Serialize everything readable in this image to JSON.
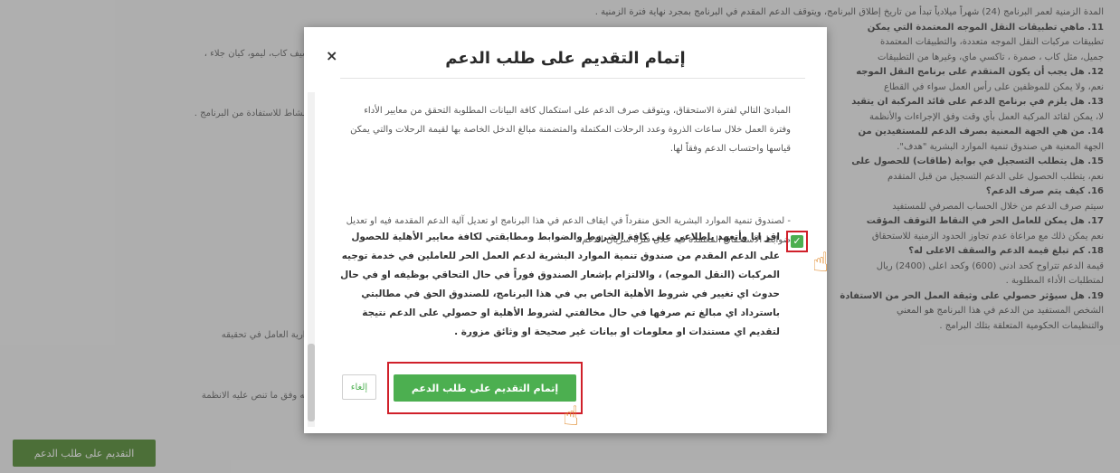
{
  "background": {
    "lines": [
      {
        "text": "المدة الزمنية لعمر البرنامج (24) شهراً ميلادياً تبدأ من تاريخ إطلاق البرنامج، ويتوقف الدعم المقدم في البرنامج بمجرد نهاية فترة الزمنية .",
        "q": false
      },
      {
        "text": "11. ماهي تطبيقات النقل الموجه المعتمدة التي يمكن",
        "q": true
      },
      {
        "text": "تطبيقات مركبات النقل الموجه متعددة، والتطبيقات المعتمدة",
        "q": false
      },
      {
        "text": "جميل، مثل كاب ، صمرة ، تاكسي ماي، وغيرها من التطبيقات",
        "q": false
      },
      {
        "text": "12. هل يجب أن يكون المتقدم على برنامج النقل الموجه",
        "q": true
      },
      {
        "text": "نعم، ولا يمكن للموظفين على رأس العمل سواء في القطاع",
        "q": false
      },
      {
        "text": "13. هل يلزم في برنامج الدعم على قائد المركبة ان يتقيد",
        "q": true
      },
      {
        "text": "لا، يمكن لقائد المركبة العمل بأي وقت وفق الإجراءات والأنظمة",
        "q": false
      },
      {
        "text": "14. من هي الجهة المعنية بصرف الدعم للمستفيدين من",
        "q": true
      },
      {
        "text": "الجهة المعنية هي صندوق تنمية الموارد البشرية \"هدف\".",
        "q": false
      },
      {
        "text": "15. هل يتطلب التسجيل في بوابة (طاقات) للحصول على",
        "q": true
      },
      {
        "text": "نعم، يتطلب الحصول على الدعم التسجيل من قبل المتقدم",
        "q": false
      },
      {
        "text": "16. كيف يتم صرف الدعم؟",
        "q": true
      },
      {
        "text": "سيتم صرف الدعم من خلال الحساب المصرفي للمستفيد",
        "q": false
      },
      {
        "text": "17. هل يمكن للعامل الحر في النقاط التوقف المؤقت",
        "q": true
      },
      {
        "text": "نعم يمكن ذلك مع مراعاة عدم تجاوز الحدود الزمنية للاستحقاق",
        "q": false
      },
      {
        "text": "18. كم تبلغ قيمة الدعم والسقف الاعلى له؟",
        "q": true
      },
      {
        "text": "قيمة الدعم تتراوح كحد ادنى (600) وكحد اعلى (2400) ريال",
        "q": false
      },
      {
        "text": "لمتطلبات الأداء المطلوبة .",
        "q": false
      },
      {
        "text": "19. هل سيؤثر حصولي على وثيقة العمل الحر من الاستفادة",
        "q": true
      },
      {
        "text": "الشخص المستفيد من الدعم في هذا البرنامج هو المعني",
        "q": false
      },
      {
        "text": "والتنظيمات الحكومية المتعلقة بتلك البرامج .",
        "q": false
      }
    ],
    "left_fragments": [
      "كريم، ماي تاكسي، او يو سيف كاب، ليمو، كيان جلاء ،",
      "فاد النقل العمل في هذا النشاط للاستفادة من البرنامج .",
      "شهر والمعتمد على استمرارية العامل في تحقيقه",
      "ات حكومية اخرى مقدمة له وفق ما تنص عليه الانظمة"
    ],
    "apply_button": "التقديم على طلب الدعم"
  },
  "modal": {
    "title": "إتمام التقديم على طلب الدعم",
    "close_symbol": "×",
    "paragraph1": "المبادئ التالي لفترة الاستحقاق، ويتوقف صرف الدعم على استكمال كافة البيانات المطلوبة التحقق من معايير الأداء وفترة العمل خلال ساعات الذروة وعدد الرحلات المكتملة والمتضمنة مبالغ الدخل الخاصة بها لقيمة الرحلات والتي يمكن قياسها واحتساب الدعم وفقاً لها.",
    "paragraph2": "- لصندوق تنمية الموارد البشرية الحق منفرداً في ايقاف الدعم في هذا البرنامج او تعديل آلية الدعم المقدمة فيه او تعديل ضوابط الاستحقاق المعتمدة فيه خلال فترة سريان الدعم.",
    "agreement": "اقر انا وأتعهد باطلاعي على كافة الشروط والضوابط ومطابقتي لكافة معايير الأهلية للحصول على الدعم المقدم من صندوق تنمية الموارد البشرية لدعم العمل الحر للعاملين في خدمة توجيه المركبات (النقل الموجه) ، والالتزام بإشعار الصندوق فوراً في حال التحاقي بوظيفه او في حال حدوث اي تغيير في شروط الأهلية الخاص بي في هذا البرنامج، للصندوق الحق في مطالبتي باسترداد اي مبالغ تم صرفها في حال مخالفتي لشروط الأهلية او حصولي على الدعم نتيجة لتقديم اي مستندات او معلومات او بيانات غير صحيحة او وثائق مزورة .",
    "agreement_checked": true,
    "check_symbol": "✓",
    "submit_label": "إتمام التقديم على طلب الدعم",
    "cancel_label": "إلغاء"
  },
  "colors": {
    "primary_green": "#4caf50",
    "highlight_red": "#d0202a",
    "hand_orange": "#e08a2c"
  }
}
